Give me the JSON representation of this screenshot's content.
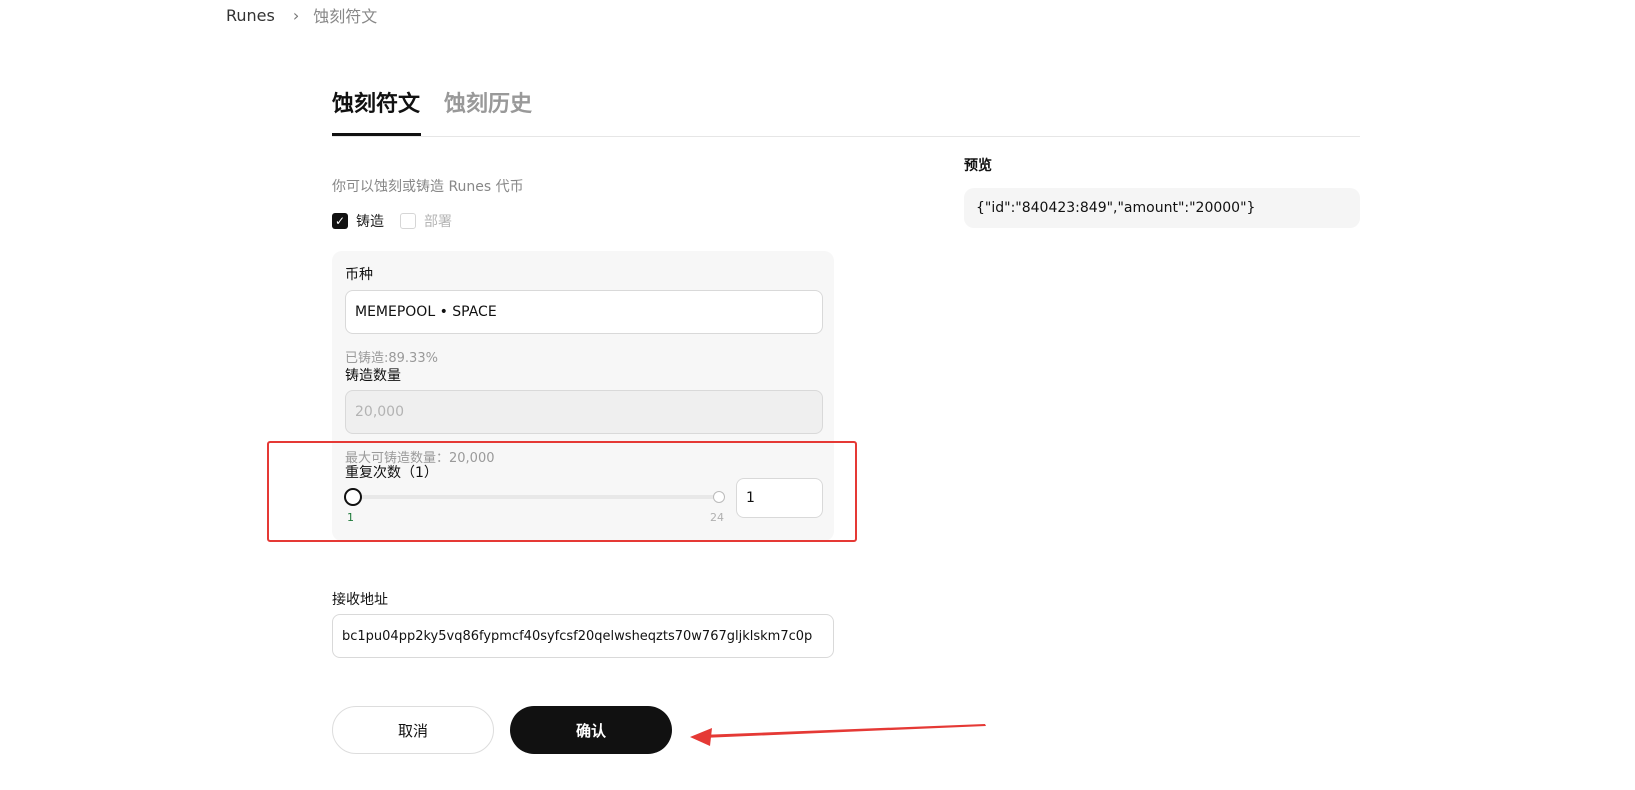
{
  "breadcrumb": {
    "root": "Runes",
    "separator": "›",
    "current": "蚀刻符文"
  },
  "tabs": {
    "active": "蚀刻符文",
    "inactive": "蚀刻历史"
  },
  "form": {
    "hint": "你可以蚀刻或铸造 Runes 代币",
    "mode_mint_label": "铸造",
    "mode_deploy_label": "部署",
    "mode_mint_checked": true,
    "mode_deploy_checked": false,
    "currency_label": "币种",
    "currency_value": "MEMEPOOL • SPACE",
    "minted_text": "已铸造:89.33%",
    "amount_label": "铸造数量",
    "amount_placeholder": "20,000",
    "max_text": "最大可铸造数量：20,000",
    "repeat_label": "重复次数（1）",
    "repeat_min": "1",
    "repeat_max": "24",
    "repeat_value": "1",
    "address_label": "接收地址",
    "address_value": "bc1pu04pp2ky5vq86fypmcf40syfcsf20qelwsheqzts70w767gljklskm7c0p"
  },
  "buttons": {
    "cancel": "取消",
    "confirm": "确认"
  },
  "preview": {
    "label": "预览",
    "value": "{\"id\":\"840423:849\",\"amount\":\"20000\"}"
  },
  "colors": {
    "accent": "#111111",
    "highlight": "#e53935",
    "slider_min": "#1f7a3a"
  }
}
